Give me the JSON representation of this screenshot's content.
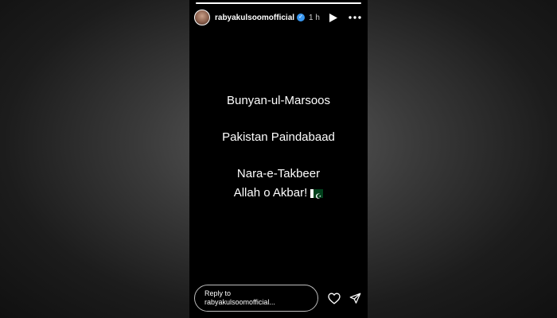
{
  "story": {
    "progress": 1.0,
    "header": {
      "username": "rabyakulsoomofficial",
      "time": "1 h",
      "verified": true,
      "play_icon": "play-icon",
      "more_icon": "more-options-icon"
    },
    "lines": [
      "Bunyan-ul-Marsoos",
      "Pakistan Paindabaad",
      "Nara-e-Takbeer",
      "Allah o Akbar!"
    ],
    "emoji": "pakistan-flag",
    "footer": {
      "reply_line1": "Reply to",
      "reply_line2": "rabyakulsoomofficial...",
      "like_icon": "heart-icon",
      "share_icon": "send-icon"
    }
  },
  "colors": {
    "story_bg": "#000000",
    "verified": "#3897f0",
    "text": "#ffffff"
  }
}
